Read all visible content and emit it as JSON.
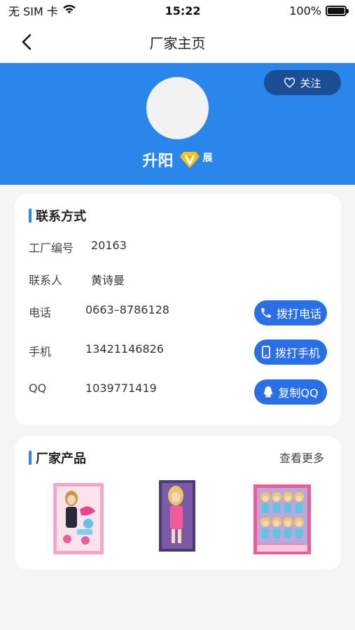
{
  "status_bar": {
    "carrier": "无 SIM 卡",
    "time": "15:22",
    "battery": "100%"
  },
  "nav": {
    "title": "厂家主页"
  },
  "header": {
    "follow_label": "关注",
    "brand_name": "升阳",
    "exhibit_tag": "展"
  },
  "contact": {
    "section_title": "联系方式",
    "factory_no_label": "工厂编号",
    "factory_no_value": "20163",
    "contact_person_label": "联系人",
    "contact_person_value": "黄诗曼",
    "phone_label": "电话",
    "phone_value": "0663–8786128",
    "phone_action": "拨打电话",
    "mobile_label": "手机",
    "mobile_value": "13421146826",
    "mobile_action": "拨打手机",
    "qq_label": "QQ",
    "qq_value": "1039771419",
    "qq_action": "复制QQ"
  },
  "products": {
    "section_title": "厂家产品",
    "more_label": "查看更多"
  },
  "colors": {
    "primary": "#2b86ec",
    "button": "#2a6fe6",
    "follow_bg": "#1a4f95"
  }
}
